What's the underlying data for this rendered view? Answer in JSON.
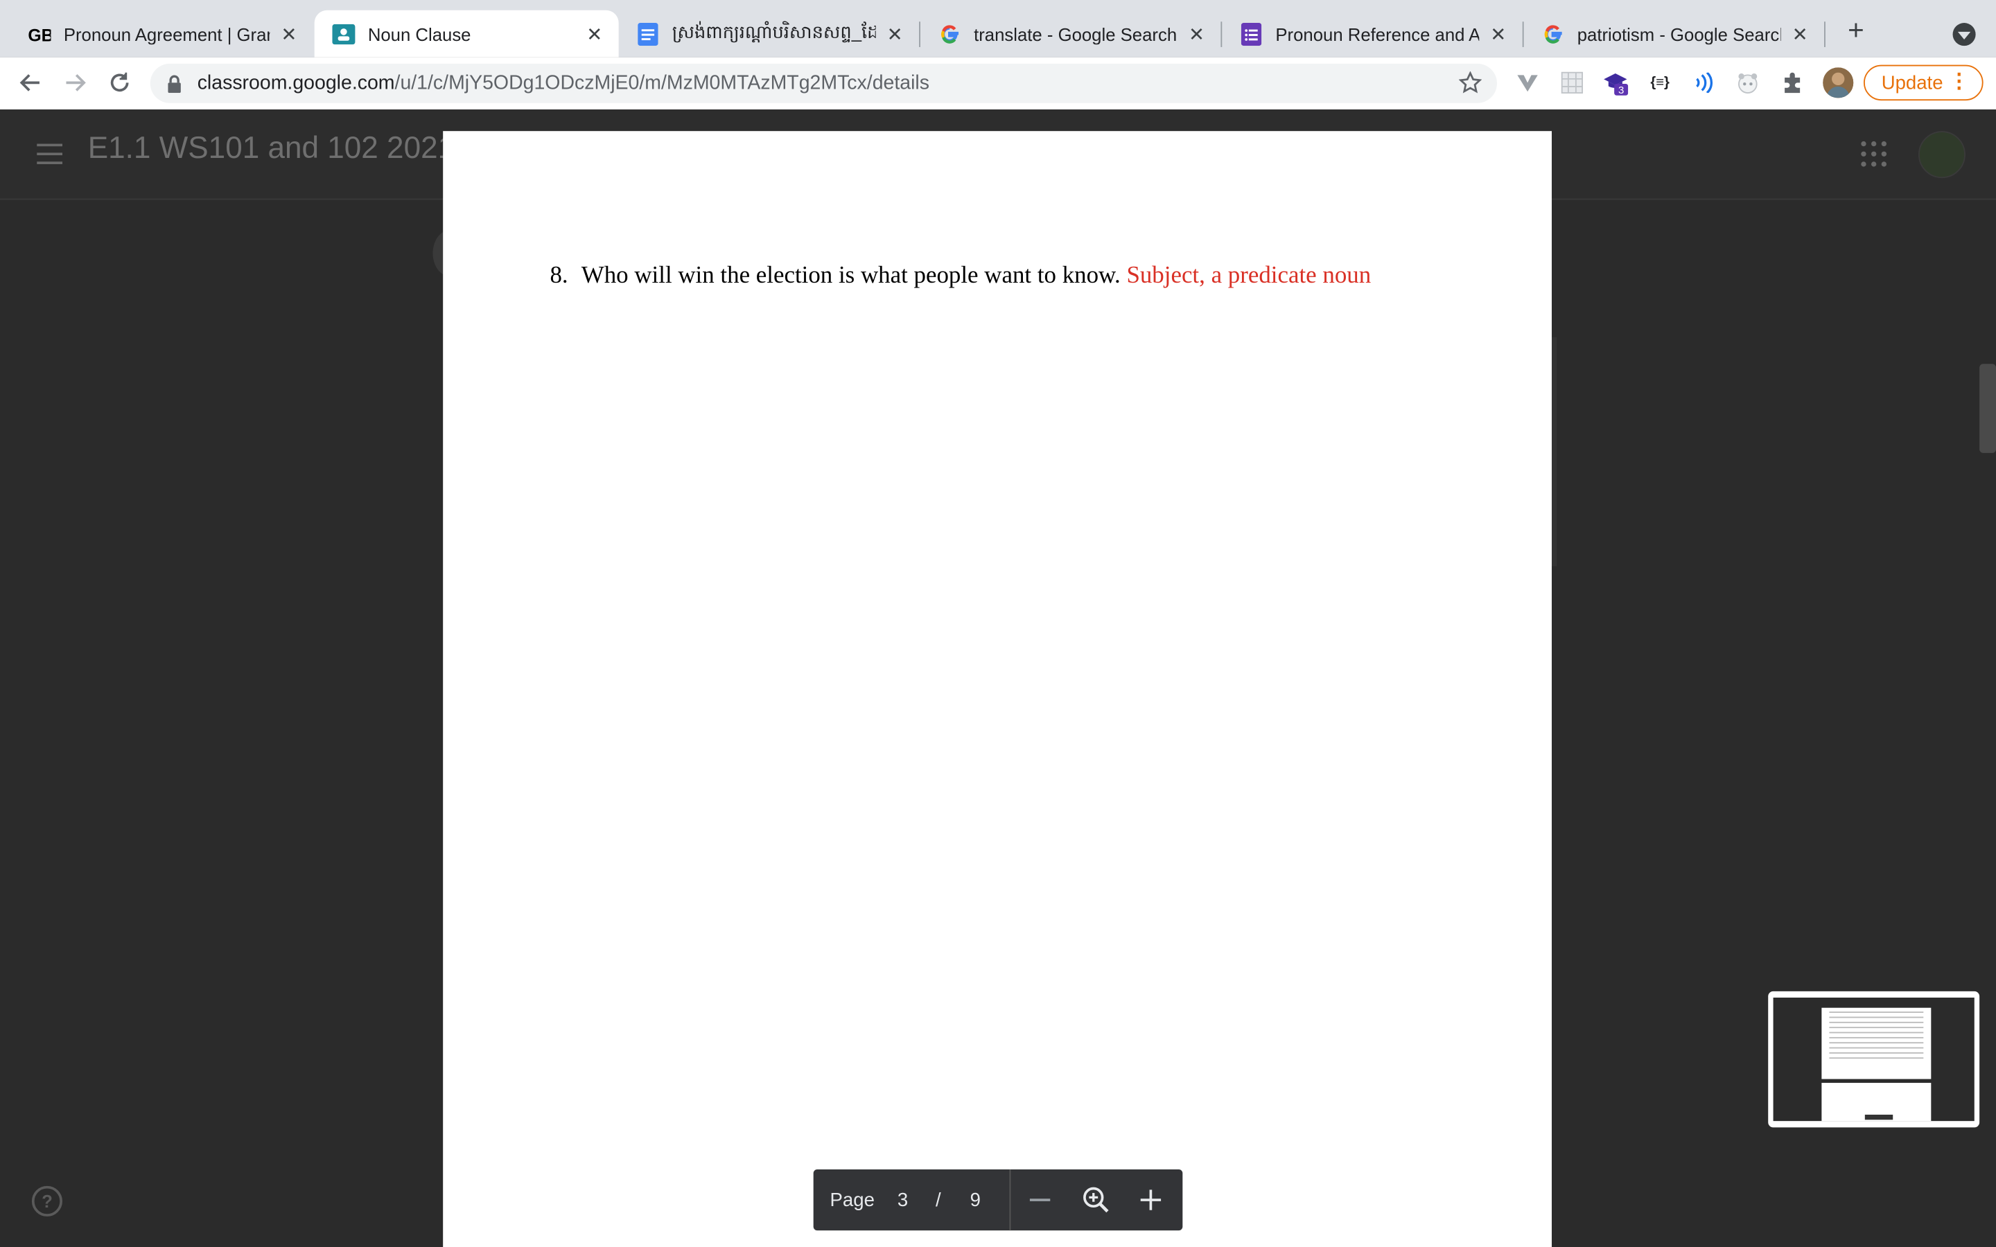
{
  "browser": {
    "tabs": [
      {
        "title": "Pronoun Agreement | Gramm",
        "icon": "grammarbook-icon",
        "active": false
      },
      {
        "title": "Noun Clause",
        "icon": "classroom-icon",
        "active": true
      },
      {
        "title": "ស្រង់ពាក្យរណ្តាំបរិសានសព្ទ_ដែលផ្ទៀ",
        "icon": "google-docs-icon",
        "active": false
      },
      {
        "title": "translate - Google Search",
        "icon": "google-icon",
        "active": false
      },
      {
        "title": "Pronoun Reference and Agr",
        "icon": "google-forms-icon",
        "active": false
      },
      {
        "title": "patriotism - Google Search",
        "icon": "google-icon",
        "active": false
      }
    ],
    "address": {
      "domain": "classroom.google.com",
      "path": "/u/1/c/MjY5ODg1ODczMjE0/m/MzM0MTAzMTg2MTcx/details"
    },
    "extension_badge": "3",
    "json_ext_label": "{≡}",
    "update_label": "Update"
  },
  "classroom": {
    "class_title": "E1.1 WS101 and 102 2021"
  },
  "document": {
    "line_number": "8.",
    "sentence": "Who will win the election is what people want to know.",
    "answer": "Subject, a predicate noun"
  },
  "page_controls": {
    "page_label": "Page",
    "current_page": "3",
    "separator": "/",
    "total_pages": "9"
  },
  "colors": {
    "answer": "#d93025",
    "update_accent": "#e8710a",
    "tab_strip": "#dee1e6"
  }
}
